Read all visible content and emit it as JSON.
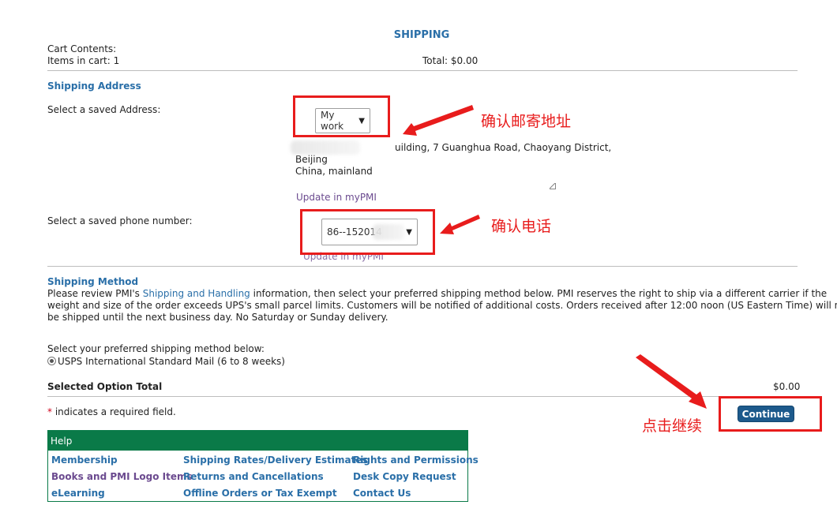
{
  "page_title": "SHIPPING",
  "cart": {
    "contents_label": "Cart Contents:",
    "items_label": "Items in cart: 1",
    "total_label": "Total: $0.00"
  },
  "shipping_address": {
    "heading": "Shipping Address",
    "select_label": "Select a saved Address:",
    "selected_address": "My work",
    "address_line1": "uilding, 7 Guanghua Road, Chaoyang District,",
    "address_line2": "Beijing",
    "address_line3": "China, mainland",
    "update_link": "Update in myPMI",
    "phone_label": "Select a saved phone number:",
    "selected_phone": "86--152014",
    "phone_update_link": "Update in myPMI"
  },
  "shipping_method": {
    "heading": "Shipping Method",
    "desc_prefix": "Please review PMI's ",
    "desc_link": "Shipping and Handling",
    "desc_suffix": " information, then select your preferred shipping method below. PMI reserves the right to ship via a different carrier if the",
    "desc_line2": "weight and size of the order exceeds UPS's small parcel limits. Customers will be notified of additional costs. Orders received after 12:00 noon (US Eastern Time) will not",
    "desc_line3": "be shipped until the next business day. No Saturday or Sunday delivery.",
    "select_prompt": "Select your preferred shipping method below:",
    "option_label": "USPS International Standard Mail (6 to 8 weeks)",
    "total_label": "Selected Option Total",
    "total_value": "$0.00"
  },
  "required_note": {
    "star": "*",
    "text": " indicates a required field."
  },
  "continue_button": "Continue",
  "annotations": {
    "confirm_address": "确认邮寄地址",
    "confirm_phone": "确认电话",
    "click_continue": "点击继续"
  },
  "help": {
    "heading": "Help",
    "col1": [
      "Membership",
      "Books and PMI Logo Items",
      "eLearning"
    ],
    "col2": [
      "Shipping Rates/Delivery Estimates",
      "Returns and Cancellations",
      "Offline Orders or Tax Exempt"
    ],
    "col3": [
      "Rights and Permissions",
      "Desk Copy Request",
      "Contact Us"
    ]
  },
  "colors": {
    "link_blue": "#2a6fa8",
    "help_green": "#0a7a48",
    "annotation_red": "#e81c1c",
    "button_blue": "#1d5a8c"
  }
}
